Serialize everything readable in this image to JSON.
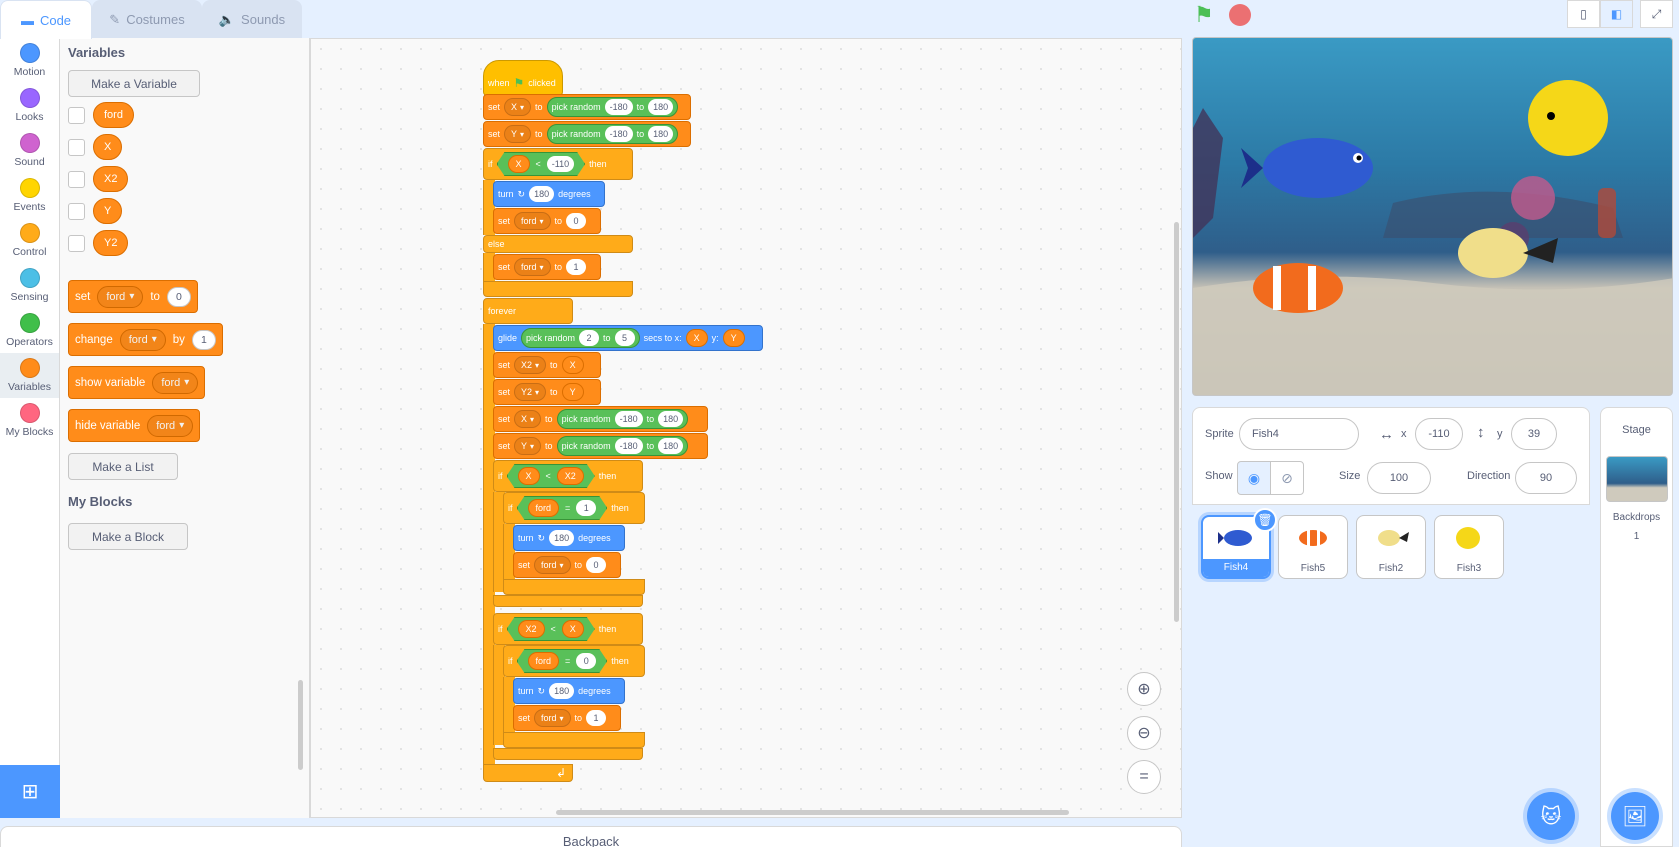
{
  "tabs": [
    {
      "label": "Code",
      "icon": "code-icon"
    },
    {
      "label": "Costumes",
      "icon": "brush-icon"
    },
    {
      "label": "Sounds",
      "icon": "speaker-icon"
    }
  ],
  "categories": [
    {
      "label": "Motion",
      "color": "#4c97ff"
    },
    {
      "label": "Looks",
      "color": "#9966ff"
    },
    {
      "label": "Sound",
      "color": "#cf63cf"
    },
    {
      "label": "Events",
      "color": "#ffd500"
    },
    {
      "label": "Control",
      "color": "#ffab19"
    },
    {
      "label": "Sensing",
      "color": "#4cbfe6"
    },
    {
      "label": "Operators",
      "color": "#40bf4a"
    },
    {
      "label": "Variables",
      "color": "#ff8c1a"
    },
    {
      "label": "My Blocks",
      "color": "#ff6680"
    }
  ],
  "palette": {
    "variables_title": "Variables",
    "make_variable": "Make a Variable",
    "variables": [
      "ford",
      "X",
      "X2",
      "Y",
      "Y2"
    ],
    "set_block": {
      "kw": "set",
      "var": "ford",
      "to": "to",
      "val": "0"
    },
    "change_block": {
      "kw": "change",
      "var": "ford",
      "by": "by",
      "val": "1"
    },
    "show_block": {
      "kw": "show variable",
      "var": "ford"
    },
    "hide_block": {
      "kw": "hide variable",
      "var": "ford"
    },
    "make_list": "Make a List",
    "myblocks_title": "My Blocks",
    "make_block": "Make a Block"
  },
  "script": {
    "when": "when",
    "clicked": "clicked",
    "set": "set",
    "to": "to",
    "pick_random": "pick random",
    "if": "if",
    "then": "then",
    "else": "else",
    "forever": "forever",
    "turn": "turn",
    "degrees": "degrees",
    "glide": "glide",
    "secs_to_x": "secs to x:",
    "y": "y:",
    "lt": "<",
    "eq": "=",
    "var_X": "X",
    "var_Y": "Y",
    "var_X2": "X2",
    "var_Y2": "Y2",
    "var_ford": "ford",
    "n_m180": "-180",
    "n_180": "180",
    "n_m110": "-110",
    "n_0": "0",
    "n_1": "1",
    "n_2": "2",
    "n_5": "5"
  },
  "backpack": "Backpack",
  "sprite_info": {
    "sprite_label": "Sprite",
    "sprite_name": "Fish4",
    "x_label": "x",
    "x_value": "-110",
    "y_label": "y",
    "y_value": "39",
    "show_label": "Show",
    "size_label": "Size",
    "size_value": "100",
    "direction_label": "Direction",
    "direction_value": "90"
  },
  "sprites": [
    {
      "name": "Fish4",
      "selected": true
    },
    {
      "name": "Fish5",
      "selected": false
    },
    {
      "name": "Fish2",
      "selected": false
    },
    {
      "name": "Fish3",
      "selected": false
    }
  ],
  "stage_pane": {
    "title": "Stage",
    "backdrops_label": "Backdrops",
    "backdrops_count": "1"
  }
}
